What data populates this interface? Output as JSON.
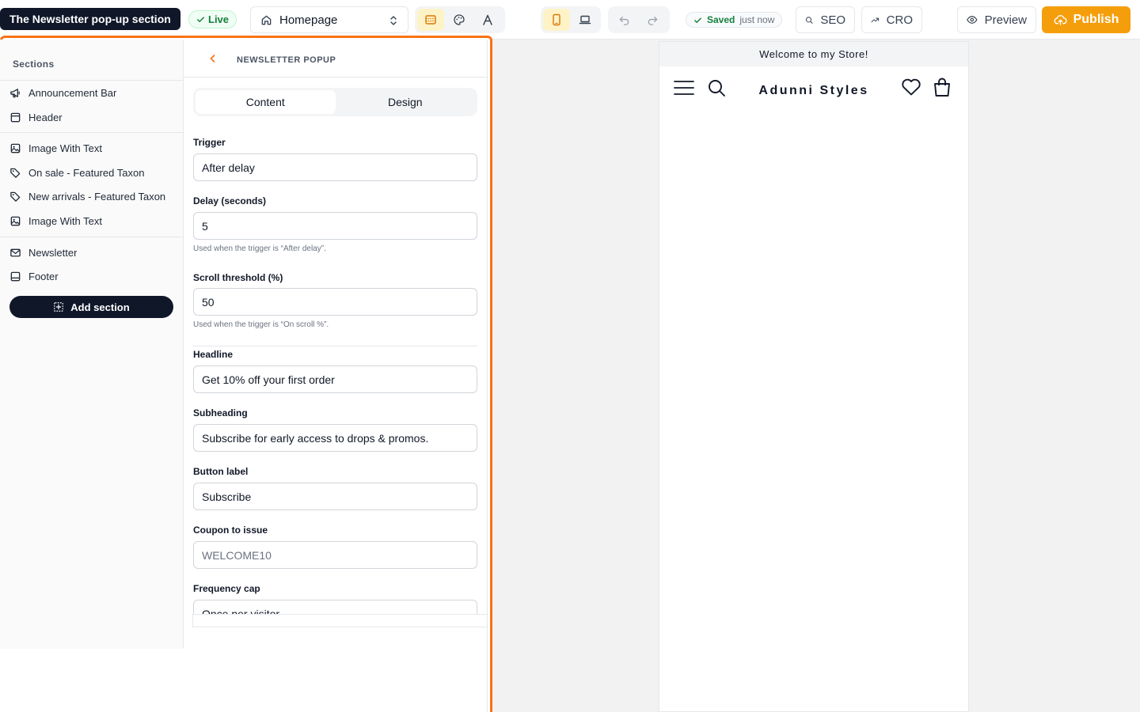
{
  "topbar": {
    "tooltip": "The Newsletter pop-up section",
    "hidden_char": "e",
    "live_label": "Live",
    "page_select": "Homepage",
    "saved_label": "Saved",
    "saved_time": "just now",
    "seo_label": "SEO",
    "cro_label": "CRO",
    "preview_label": "Preview",
    "publish_label": "Publish"
  },
  "sections": {
    "title": "Sections",
    "items": [
      {
        "label": "Announcement Bar",
        "icon": "megaphone-icon"
      },
      {
        "label": "Header",
        "icon": "layout-header-icon"
      },
      {
        "label": "Image With Text",
        "icon": "image-icon"
      },
      {
        "label": "On sale - Featured Taxon",
        "icon": "tag-icon"
      },
      {
        "label": "New arrivals - Featured Taxon",
        "icon": "tag-icon"
      },
      {
        "label": "Image With Text",
        "icon": "image-icon"
      },
      {
        "label": "Newsletter",
        "icon": "mail-icon"
      },
      {
        "label": "Footer",
        "icon": "layout-footer-icon"
      }
    ],
    "add_label": "Add section"
  },
  "settings": {
    "title": "NEWSLETTER POPUP",
    "tabs": [
      "Content",
      "Design"
    ],
    "active_tab": "Content",
    "trigger": {
      "label": "Trigger",
      "value": "After delay"
    },
    "delay": {
      "label": "Delay (seconds)",
      "value": "5",
      "hint": "Used when the trigger is “After delay”."
    },
    "scroll": {
      "label": "Scroll threshold (%)",
      "value": "50",
      "hint": "Used when the trigger is “On scroll %”."
    },
    "headline": {
      "label": "Headline",
      "value": "Get 10% off your first order"
    },
    "subheading": {
      "label": "Subheading",
      "value": "Subscribe for early access to drops & promos."
    },
    "button_label": {
      "label": "Button label",
      "value": "Subscribe"
    },
    "coupon": {
      "label": "Coupon to issue",
      "placeholder": "WELCOME10"
    },
    "frequency": {
      "label": "Frequency cap",
      "value": "Once per visitor"
    }
  },
  "preview": {
    "announcement": "Welcome to my Store!",
    "store_name": "Adunni Styles"
  },
  "colors": {
    "accent": "#f97316",
    "publish": "#f59e0b",
    "dark": "#0f1729",
    "live_green": "#15803d"
  }
}
